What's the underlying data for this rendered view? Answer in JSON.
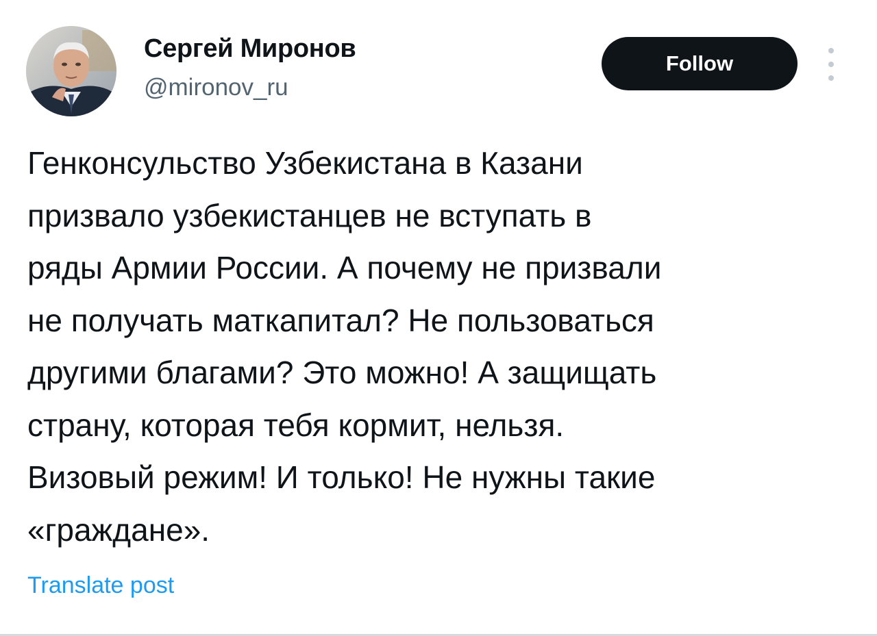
{
  "author": {
    "name": "Сергей Миронов",
    "handle": "@mironov_ru"
  },
  "follow_button": {
    "label": "Follow"
  },
  "more_menu": {
    "icon": "more-vertical-icon"
  },
  "tweet": {
    "lines": [
      "Генконсульство Узбекистана в Казани",
      "призвало узбекистанцев не вступать в",
      "ряды Армии России. А почему не призвали",
      "не получать маткапитал? Не пользоваться",
      "другими благами? Это можно! А защищать",
      "страну, которая тебя кормит, нельзя.",
      "Визовый режим! И только! Не нужны такие",
      "«граждане»."
    ]
  },
  "translate_link": {
    "label": "Translate post"
  },
  "colors": {
    "text": "#0f1419",
    "secondary": "#536471",
    "link": "#1d9bf0",
    "button_bg": "#0f1419",
    "button_text": "#ffffff"
  }
}
